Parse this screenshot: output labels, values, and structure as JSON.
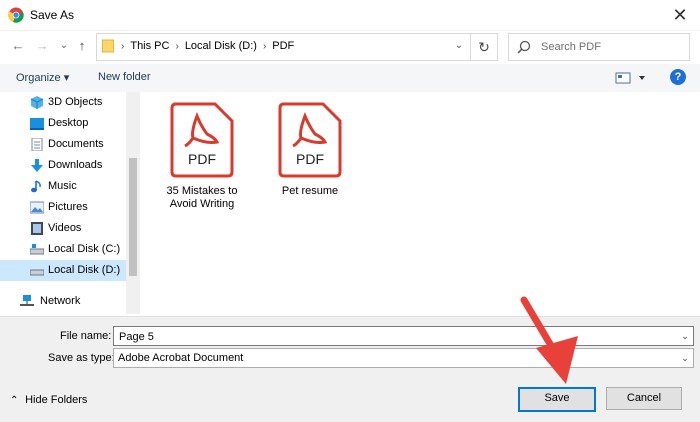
{
  "window": {
    "title": "Save As",
    "close_glyph": "✕"
  },
  "nav": {
    "back_glyph": "←",
    "forward_glyph": "→",
    "recent_glyph": "⌄",
    "up_glyph": "↑",
    "breadcrumb": [
      "This PC",
      "Local Disk (D:)",
      "PDF"
    ],
    "crumb_separator": "›",
    "dropdown_glyph": "⌄",
    "refresh_glyph": "↻",
    "search_placeholder": "Search PDF"
  },
  "toolbar": {
    "organize_label": "Organize ▾",
    "new_folder_label": "New folder",
    "help_glyph": "?"
  },
  "sidebar": {
    "items": [
      {
        "label": "3D Objects",
        "icon": "cube-icon"
      },
      {
        "label": "Desktop",
        "icon": "desktop-icon"
      },
      {
        "label": "Documents",
        "icon": "documents-icon"
      },
      {
        "label": "Downloads",
        "icon": "downloads-icon"
      },
      {
        "label": "Music",
        "icon": "music-icon"
      },
      {
        "label": "Pictures",
        "icon": "pictures-icon"
      },
      {
        "label": "Videos",
        "icon": "videos-icon"
      },
      {
        "label": "Local Disk (C:)",
        "icon": "drive-icon"
      },
      {
        "label": "Local Disk (D:)",
        "icon": "drive-icon",
        "selected": true
      }
    ],
    "network_label": "Network"
  },
  "files": [
    {
      "name": "35 Mistakes to Avoid Writing",
      "type_badge": "PDF"
    },
    {
      "name": "Pet resume",
      "type_badge": "PDF"
    }
  ],
  "form": {
    "file_name_label": "File name:",
    "file_name_value": "Page 5",
    "save_type_label": "Save as type:",
    "save_type_value": "Adobe Acrobat Document"
  },
  "footer": {
    "hide_folders_label": "Hide Folders",
    "hide_folders_glyph": "⌃",
    "save_label": "Save",
    "cancel_label": "Cancel"
  },
  "colors": {
    "pdf_red": "#d93a2b",
    "selection": "#cce8ff",
    "accent": "#0078d7",
    "annotation_arrow": "#e8413a"
  }
}
